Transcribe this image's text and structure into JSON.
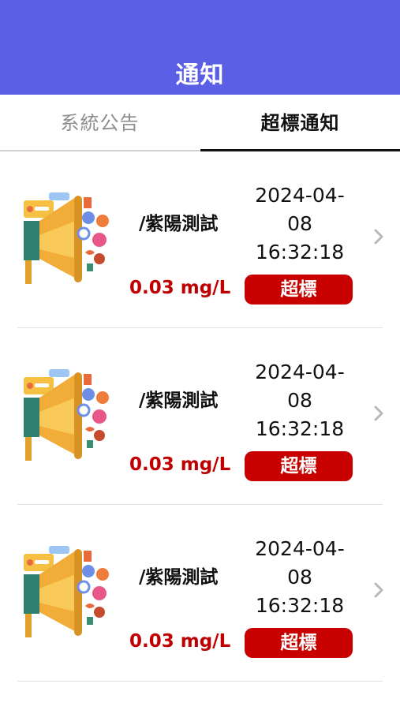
{
  "header": {
    "title": "通知"
  },
  "tabs": [
    {
      "label": "系統公告",
      "active": false
    },
    {
      "label": "超標通知",
      "active": true
    }
  ],
  "notifications": [
    {
      "name": "/紫陽測試",
      "value": "0.03 mg/L",
      "date": "2024-04-",
      "date2": "08",
      "time": "16:32:18",
      "status": "超標"
    },
    {
      "name": "/紫陽測試",
      "value": "0.03 mg/L",
      "date": "2024-04-",
      "date2": "08",
      "time": "16:32:18",
      "status": "超標"
    },
    {
      "name": "/紫陽測試",
      "value": "0.03 mg/L",
      "date": "2024-04-",
      "date2": "08",
      "time": "16:32:18",
      "status": "超標"
    }
  ],
  "colors": {
    "header_bg": "#5a5fe6",
    "alert_red": "#c80000",
    "value_red": "#c00000"
  },
  "icons": {
    "thumbnail": "megaphone-icon",
    "row_arrow": "chevron-right-icon"
  }
}
